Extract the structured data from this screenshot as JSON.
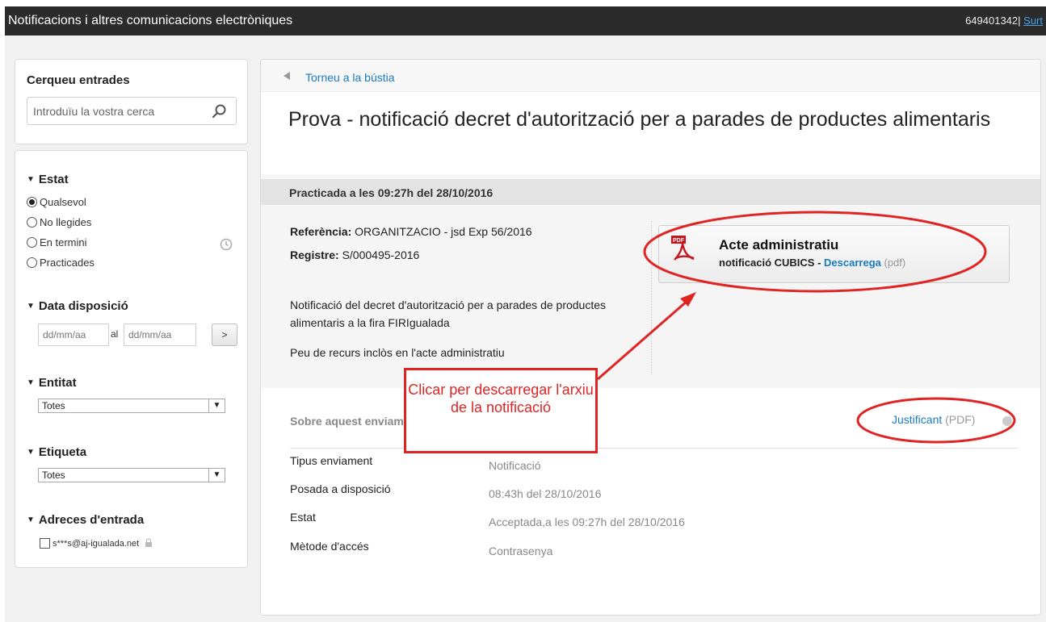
{
  "header": {
    "title": "Notificacions i altres comunicacions electròniques",
    "user_id": "649401342",
    "separator": "|",
    "logout_label": "Surt"
  },
  "sidebar": {
    "search": {
      "heading": "Cerqueu entrades",
      "placeholder": "Introduïu la vostra cerca",
      "icon": "search-icon"
    },
    "estat": {
      "title": "Estat",
      "options": [
        "Qualsevol",
        "No llegides",
        "En termini",
        "Practicades"
      ],
      "selected": "Qualsevol"
    },
    "data_disposicio": {
      "title": "Data disposició",
      "from_placeholder": "dd/mm/aa",
      "connector": "al",
      "to_placeholder": "dd/mm/aa",
      "go_label": ">"
    },
    "entitat": {
      "title": "Entitat",
      "selected": "Totes"
    },
    "etiqueta": {
      "title": "Etiqueta",
      "selected": "Totes"
    },
    "adreces": {
      "title": "Adreces d'entrada",
      "email": "s***s@aj-igualada.net"
    }
  },
  "main": {
    "back_link": "Torneu a la bústia",
    "title": "Prova - notificació decret d'autorització per a parades de productes alimentaris",
    "practicada": "Practicada a les 09:27h del 28/10/2016",
    "referencia_label": "Referència:",
    "referencia_value": "ORGANITZACIO - jsd Exp 56/2016",
    "registre_label": "Registre:",
    "registre_value": "S/000495-2016",
    "description": "Notificació del decret d'autorització per a parades de productes alimentaris a la fira FIRIgualada",
    "peu": "Peu de recurs inclòs en l'acte administratiu",
    "document": {
      "title": "Acte administratiu",
      "subtitle": "notificació CUBICS",
      "dash": " - ",
      "download_label": "Descarrega",
      "format": "(pdf)",
      "icon": "pdf-icon"
    },
    "about_title": "Sobre aquest enviament",
    "justificant_label": "Justificant",
    "justificant_format": "(PDF)",
    "details": [
      {
        "key": "Tipus enviament",
        "value": "Notificació"
      },
      {
        "key": "Posada a disposició",
        "value": "08:43h del 28/10/2016"
      },
      {
        "key": "Estat",
        "value": "Acceptada,a les 09:27h del 28/10/2016"
      },
      {
        "key": "Mètode d'accés",
        "value": "Contrasenya"
      }
    ]
  },
  "annotation": {
    "callout_text": "Clicar per descarregar l'arxiu de la notificació",
    "color": "#e02424"
  },
  "colors": {
    "header_bg": "#2b2b2b",
    "link": "#1a7bbf",
    "page_bg": "#f1f1f1"
  }
}
